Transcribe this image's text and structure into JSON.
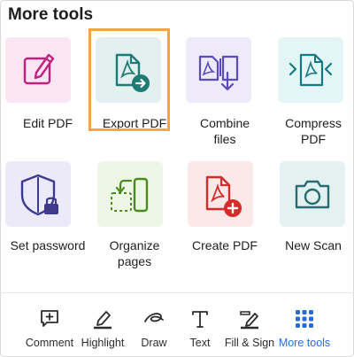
{
  "panel": {
    "title": "More tools"
  },
  "tools": [
    {
      "label_lines": [
        "Edit PDF"
      ],
      "icon": "edit-pdf-icon",
      "tile_color": "#fae6f3",
      "icon_color": "#c2207f"
    },
    {
      "label_lines": [
        "Export PDF"
      ],
      "icon": "export-pdf-icon",
      "tile_color": "#e2f1ef",
      "icon_color": "#1e7a74",
      "selected": true
    },
    {
      "label_lines": [
        "Combine",
        "files"
      ],
      "icon": "combine-files-icon",
      "tile_color": "#eeeaf9",
      "icon_color": "#5a4bb8"
    },
    {
      "label_lines": [
        "Compress",
        "PDF"
      ],
      "icon": "compress-pdf-icon",
      "tile_color": "#e4f5f6",
      "icon_color": "#137a84"
    },
    {
      "label_lines": [
        "Set password"
      ],
      "icon": "set-password-icon",
      "tile_color": "#eceaf9",
      "icon_color": "#3f3a8c"
    },
    {
      "label_lines": [
        "Organize",
        "pages"
      ],
      "icon": "organize-pages-icon",
      "tile_color": "#eef6e6",
      "icon_color": "#4b8a1e"
    },
    {
      "label_lines": [
        "Create PDF"
      ],
      "icon": "create-pdf-icon",
      "tile_color": "#fbe8e8",
      "icon_color": "#d42b2b"
    },
    {
      "label_lines": [
        "New Scan"
      ],
      "icon": "camera-icon",
      "tile_color": "#e4f1f1",
      "icon_color": "#2a6c73"
    }
  ],
  "toolbar": {
    "items": [
      {
        "label": "Comment",
        "icon": "comment-icon"
      },
      {
        "label": "Highlight",
        "icon": "highlight-icon"
      },
      {
        "label": "Draw",
        "icon": "draw-icon"
      },
      {
        "label": "Text",
        "icon": "text-icon"
      },
      {
        "label": "Fill & Sign",
        "icon": "fill-sign-icon"
      },
      {
        "label": "More tools",
        "icon": "grid-icon",
        "active": true
      }
    ],
    "active_color": "#2b6cd8"
  }
}
